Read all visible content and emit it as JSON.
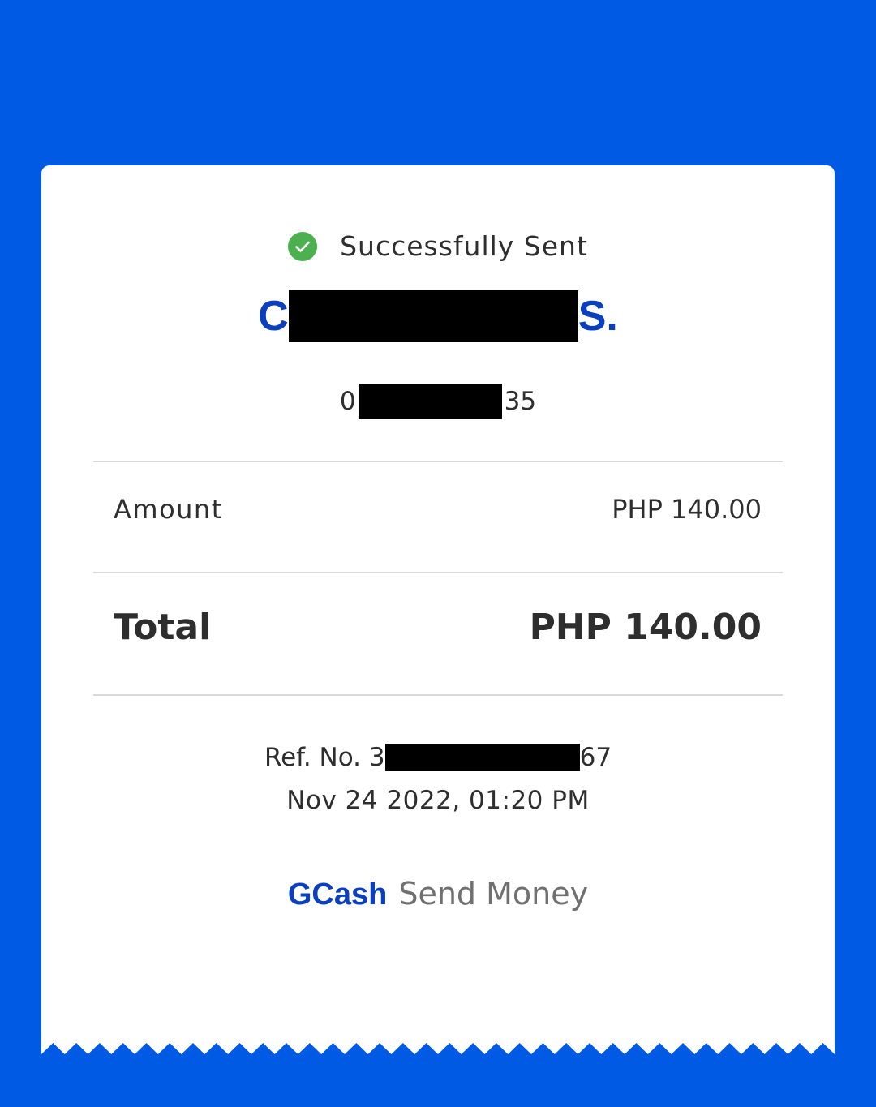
{
  "colors": {
    "background": "#015ae4",
    "brand_blue": "#0a3fbf",
    "success_green": "#4caf50"
  },
  "status": {
    "icon": "check-circle-icon",
    "text": "Successfully Sent"
  },
  "recipient": {
    "name_start": "C",
    "name_end": "S.",
    "number_start": "0",
    "number_end": "35"
  },
  "amount": {
    "label": "Amount",
    "value": "PHP 140.00"
  },
  "total": {
    "label": "Total",
    "value": "PHP 140.00"
  },
  "reference": {
    "prefix": "Ref. No. 3",
    "suffix": "67"
  },
  "timestamp": "Nov 24 2022, 01:20 PM",
  "footer": {
    "brand": "GCash",
    "service": "Send Money"
  }
}
